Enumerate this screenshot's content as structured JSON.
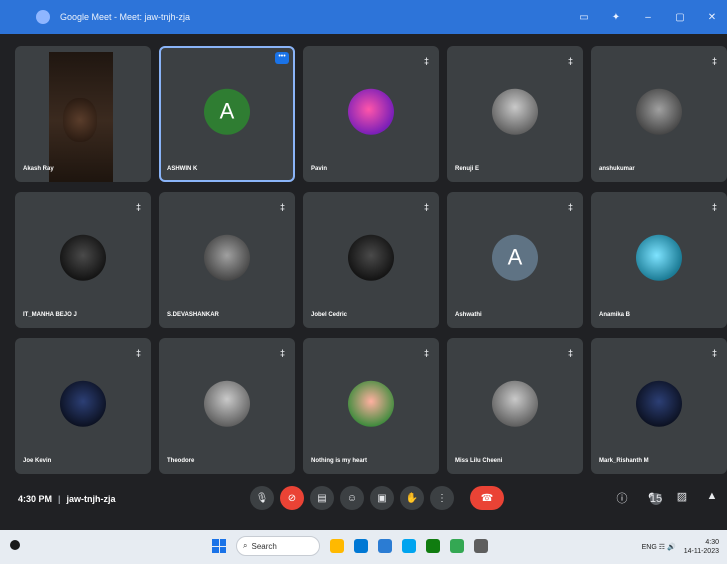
{
  "window": {
    "title": "Google Meet - Meet: jaw-tnjh-zja"
  },
  "tiles": [
    {
      "name": "Akash Ray",
      "kind": "camera"
    },
    {
      "name": "ASHWIN K",
      "initial": "A",
      "style": "green",
      "active": true
    },
    {
      "name": "Pavin",
      "style": "pink"
    },
    {
      "name": "Renuji E",
      "style": "photo"
    },
    {
      "name": "anshukumar",
      "style": "grey"
    },
    {
      "name": "IT_MANHA BEJO J",
      "style": "dark"
    },
    {
      "name": "S.DEVASHANKAR",
      "style": "grey"
    },
    {
      "name": "Jobel Cedric",
      "style": "dark"
    },
    {
      "name": "Ashwathi",
      "initial": "A",
      "style": "slate"
    },
    {
      "name": "Anamika B",
      "style": "cyan"
    },
    {
      "name": "Joe Kevin",
      "style": "navy"
    },
    {
      "name": "Theodore",
      "style": "photo"
    },
    {
      "name": "Nothing is my heart",
      "style": "rose"
    },
    {
      "name": "Miss Lilu Cheeni",
      "style": "photo"
    },
    {
      "name": "Mark_Rishanth M",
      "style": "navy"
    }
  ],
  "mute_glyph": "‡",
  "more_glyph": "•••",
  "meeting": {
    "time": "4:30 PM",
    "separator": "|",
    "code": "jaw-tnjh-zja"
  },
  "controls": [
    {
      "name": "mic-button",
      "glyph": "🎙",
      "red": false
    },
    {
      "name": "camera-off-button",
      "glyph": "⊘",
      "red": true
    },
    {
      "name": "captions-button",
      "glyph": "▤",
      "red": false
    },
    {
      "name": "emoji-button",
      "glyph": "☺",
      "red": false
    },
    {
      "name": "present-button",
      "glyph": "▣",
      "red": false
    },
    {
      "name": "raise-hand-button",
      "glyph": "✋",
      "red": false
    },
    {
      "name": "more-options-button",
      "glyph": "⋮",
      "red": false
    }
  ],
  "end_call": {
    "glyph": "☎"
  },
  "right_controls": [
    {
      "name": "info-icon",
      "glyph": "ⓘ"
    },
    {
      "name": "people-icon",
      "glyph": "☻",
      "badge": "15"
    },
    {
      "name": "chat-icon",
      "glyph": "▨"
    },
    {
      "name": "activities-icon",
      "glyph": "▲"
    }
  ],
  "taskbar": {
    "search_placeholder": "Search",
    "app_colors": [
      "#ffb900",
      "#0078d4",
      "#2b7cd3",
      "#00a4ef",
      "#107c10",
      "#34a853",
      "#5e5e5e"
    ],
    "tray": "ENG  ☶ 🔊",
    "clock_time": "4:30",
    "clock_date": "14-11-2023"
  }
}
